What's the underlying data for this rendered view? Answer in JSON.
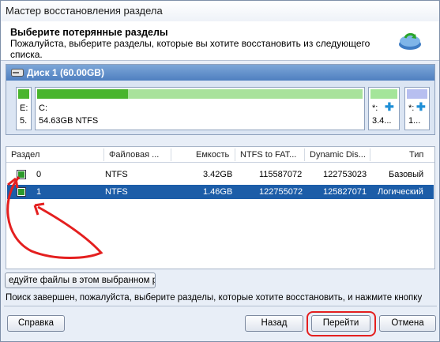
{
  "window": {
    "title": "Мастер восстановления раздела"
  },
  "header": {
    "title": "Выберите потерянные разделы",
    "description": "Пожалуйста, выберите разделы, которые вы хотите восстановить из следующего списка."
  },
  "disk": {
    "label": "Диск 1 (60.00GB)",
    "partitions": [
      {
        "line1": "E:",
        "line2": "5.",
        "color": "#49b52d"
      },
      {
        "line1": "C:",
        "line2": "54.63GB NTFS",
        "color": "#49b52d",
        "fill_fraction": 0.28
      },
      {
        "line1": "*:",
        "line2": "3.4...",
        "color": "#a4e59a"
      },
      {
        "line1": "*:",
        "line2": "1...",
        "color": "#b7bff0"
      }
    ]
  },
  "table": {
    "columns": [
      "Раздел",
      "Файловая ...",
      "Емкость",
      "NTFS to FAT...",
      "Dynamic Dis...",
      "Тип"
    ],
    "rows": [
      {
        "name": "0",
        "fs": "NTFS",
        "capacity": "3.42GB",
        "ntfs_to_fat": "115587072",
        "dynamic": "122753023",
        "type": "Базовый"
      },
      {
        "name": "1",
        "fs": "NTFS",
        "capacity": "1.46GB",
        "ntfs_to_fat": "122755072",
        "dynamic": "125827071",
        "type": "Логический"
      }
    ]
  },
  "file_button": "едуйте файлы в этом выбранном раз",
  "status": "Поиск завершен, пожалуйста, выберите разделы, которые хотите восстановить, и нажмите кнопку",
  "buttons": {
    "help": "Справка",
    "back": "Назад",
    "go": "Перейти",
    "cancel": "Отмена"
  },
  "colors": {
    "selection": "#1c5da8",
    "accent_red": "#e41f1f",
    "disk_header": "#4f7fc0"
  }
}
